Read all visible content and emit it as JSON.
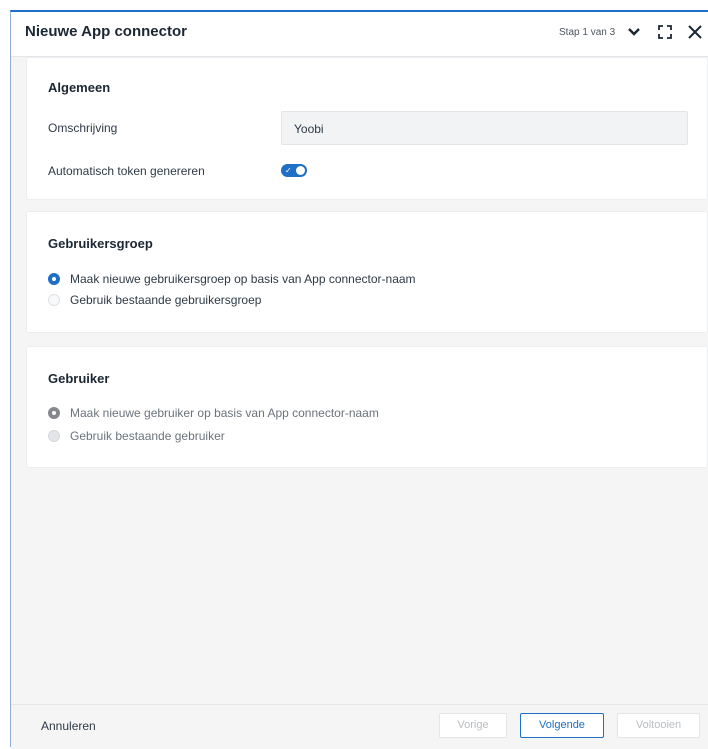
{
  "header": {
    "title": "Nieuwe App connector",
    "step": "Stap 1 van 3",
    "icons": {
      "collapse": "chevron-down-icon",
      "expand": "expand-icon",
      "close": "close-icon"
    }
  },
  "general": {
    "title": "Algemeen",
    "description_label": "Omschrijving",
    "description_value": "Yoobi",
    "auto_token_label": "Automatisch token genereren",
    "auto_token_on": true
  },
  "usergroup": {
    "title": "Gebruikersgroep",
    "options": [
      {
        "label": "Maak nieuwe gebruikersgroep op basis van App connector-naam",
        "selected": true
      },
      {
        "label": "Gebruik bestaande gebruikersgroep",
        "selected": false
      }
    ]
  },
  "user": {
    "title": "Gebruiker",
    "disabled": true,
    "options": [
      {
        "label": "Maak nieuwe gebruiker op basis van App connector-naam",
        "selected": true
      },
      {
        "label": "Gebruik bestaande gebruiker",
        "selected": false
      }
    ]
  },
  "footer": {
    "cancel": "Annuleren",
    "previous": "Vorige",
    "next": "Volgende",
    "finish": "Voltooien"
  },
  "colors": {
    "accent": "#1f6fc6",
    "background": "#f5f5f6"
  }
}
